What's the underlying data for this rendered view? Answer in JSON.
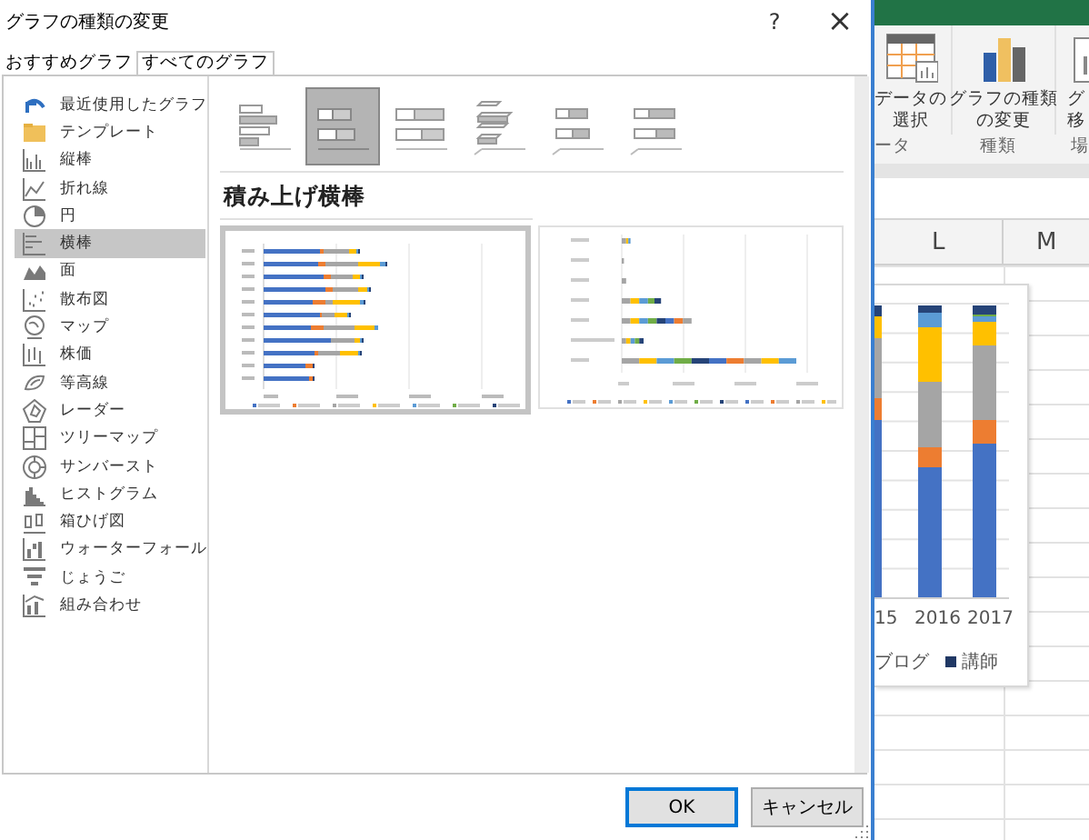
{
  "window": {
    "title": "グラフの種類の変更",
    "help": "?",
    "close": "×"
  },
  "tabs": [
    {
      "label": "おすすめグラフ",
      "selected": false
    },
    {
      "label": "すべてのグラフ",
      "selected": true
    }
  ],
  "chart_types": [
    {
      "label": "最近使用したグラフ",
      "selected": false
    },
    {
      "label": "テンプレート",
      "selected": false
    },
    {
      "label": "縦棒",
      "selected": false
    },
    {
      "label": "折れ線",
      "selected": false
    },
    {
      "label": "円",
      "selected": false
    },
    {
      "label": "横棒",
      "selected": true
    },
    {
      "label": "面",
      "selected": false
    },
    {
      "label": "散布図",
      "selected": false
    },
    {
      "label": "マップ",
      "selected": false
    },
    {
      "label": "株価",
      "selected": false
    },
    {
      "label": "等高線",
      "selected": false
    },
    {
      "label": "レーダー",
      "selected": false
    },
    {
      "label": "ツリーマップ",
      "selected": false
    },
    {
      "label": "サンバースト",
      "selected": false
    },
    {
      "label": "ヒストグラム",
      "selected": false
    },
    {
      "label": "箱ひげ図",
      "selected": false
    },
    {
      "label": "ウォーターフォール",
      "selected": false
    },
    {
      "label": "じょうご",
      "selected": false
    },
    {
      "label": "組み合わせ",
      "selected": false
    }
  ],
  "subtypes": [
    {
      "selected": false
    },
    {
      "selected": true
    },
    {
      "selected": false
    },
    {
      "selected": false
    },
    {
      "selected": false
    },
    {
      "selected": false
    }
  ],
  "subtype_title": "積み上げ横棒",
  "previews": [
    {
      "selected": true
    },
    {
      "selected": false
    }
  ],
  "buttons": [
    {
      "label": "OK",
      "default": true
    },
    {
      "label": "キャンセル",
      "default": false
    }
  ],
  "excel": {
    "ribbon_buttons": [
      {
        "lines": [
          "データの",
          "選択"
        ]
      },
      {
        "lines": [
          "グラフの種類",
          "の変更"
        ]
      },
      {
        "lines": [
          "グ",
          "移"
        ]
      }
    ],
    "group_labels": [
      "ータ",
      "種類",
      "場"
    ],
    "columns": [
      "L",
      "M"
    ],
    "chart": {
      "x_labels": [
        "15",
        "2016",
        "2017"
      ],
      "legend": [
        {
          "label": "ブログ"
        },
        {
          "label": "講師",
          "color": "#203864"
        }
      ]
    }
  }
}
